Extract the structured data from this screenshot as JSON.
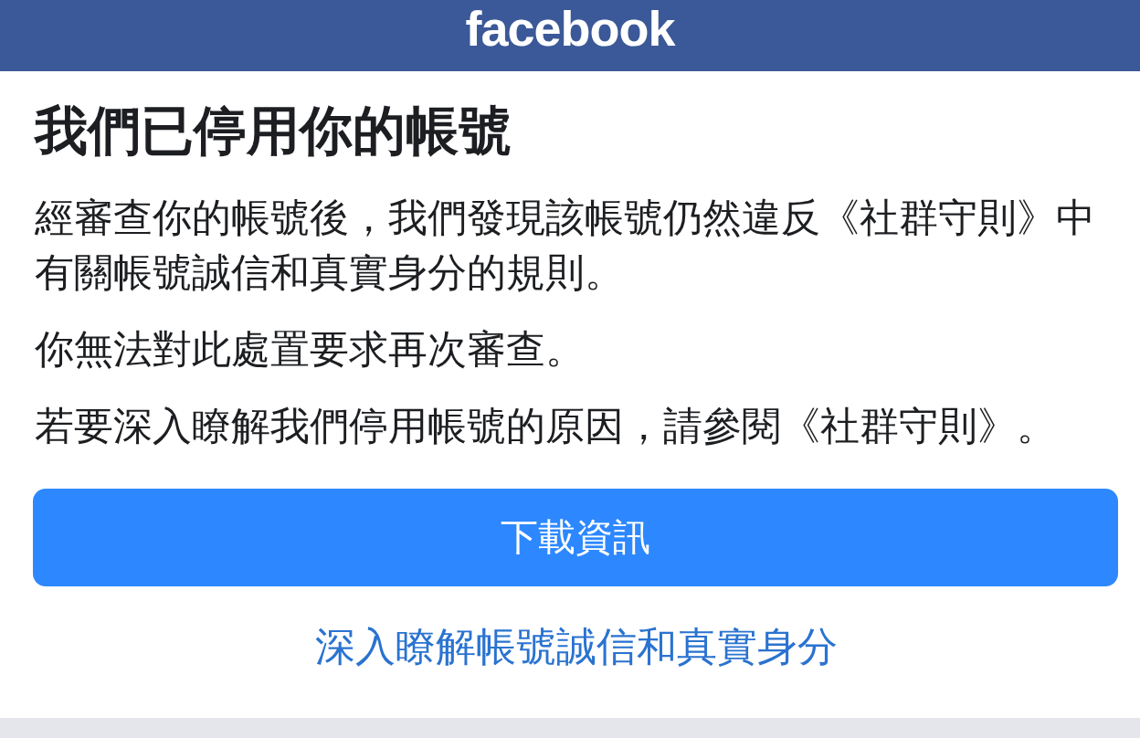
{
  "header": {
    "logo": "facebook"
  },
  "title": "我們已停用你的帳號",
  "paragraphs": [
    "經審查你的帳號後，我們發現該帳號仍然違反《社群守則》中有關帳號誠信和真實身分的規則。",
    "你無法對此處置要求再次審查。",
    "若要深入瞭解我們停用帳號的原因，請參閱《社群守則》。"
  ],
  "primary_button": "下載資訊",
  "link": "深入瞭解帳號誠信和真實身分"
}
